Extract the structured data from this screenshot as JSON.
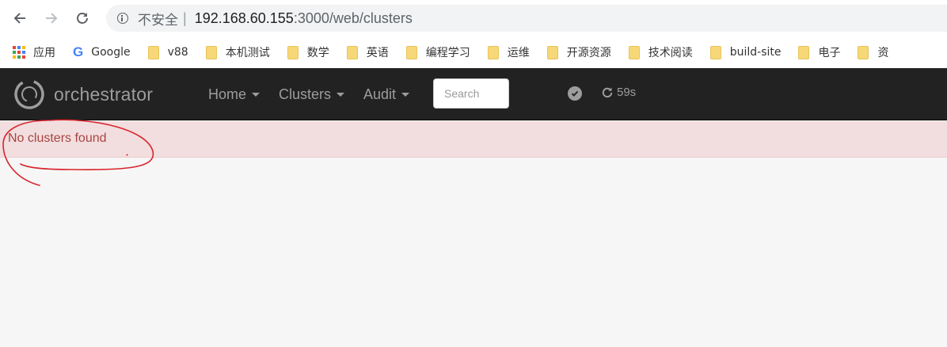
{
  "browser": {
    "security_label": "不安全",
    "separator": "|",
    "url_host": "192.168.60.155",
    "url_rest": ":3000/web/clusters"
  },
  "bookmarks": [
    {
      "label": "应用",
      "icon": "apps-icon"
    },
    {
      "label": "Google",
      "icon": "google-icon"
    },
    {
      "label": "v88",
      "icon": "folder-icon"
    },
    {
      "label": "本机测试",
      "icon": "folder-icon"
    },
    {
      "label": "数学",
      "icon": "folder-icon"
    },
    {
      "label": "英语",
      "icon": "folder-icon"
    },
    {
      "label": "编程学习",
      "icon": "folder-icon"
    },
    {
      "label": "运维",
      "icon": "folder-icon"
    },
    {
      "label": "开源资源",
      "icon": "folder-icon"
    },
    {
      "label": "技术阅读",
      "icon": "folder-icon"
    },
    {
      "label": "build-site",
      "icon": "folder-icon"
    },
    {
      "label": "电子",
      "icon": "folder-icon"
    },
    {
      "label": "资",
      "icon": "folder-icon"
    }
  ],
  "navbar": {
    "brand": "orchestrator",
    "menu": {
      "home": "Home",
      "clusters": "Clusters",
      "audit": "Audit"
    },
    "search_placeholder": "Search",
    "status_icon": "check-circle-icon",
    "refresh_label": "59s"
  },
  "alert": {
    "message": "No clusters found"
  },
  "colors": {
    "navbar_bg": "#222222",
    "navbar_text": "#9d9d9d",
    "alert_bg": "#f2dede",
    "alert_text": "#a94442",
    "annotation": "#d9232d",
    "folder": "#f7d878"
  }
}
